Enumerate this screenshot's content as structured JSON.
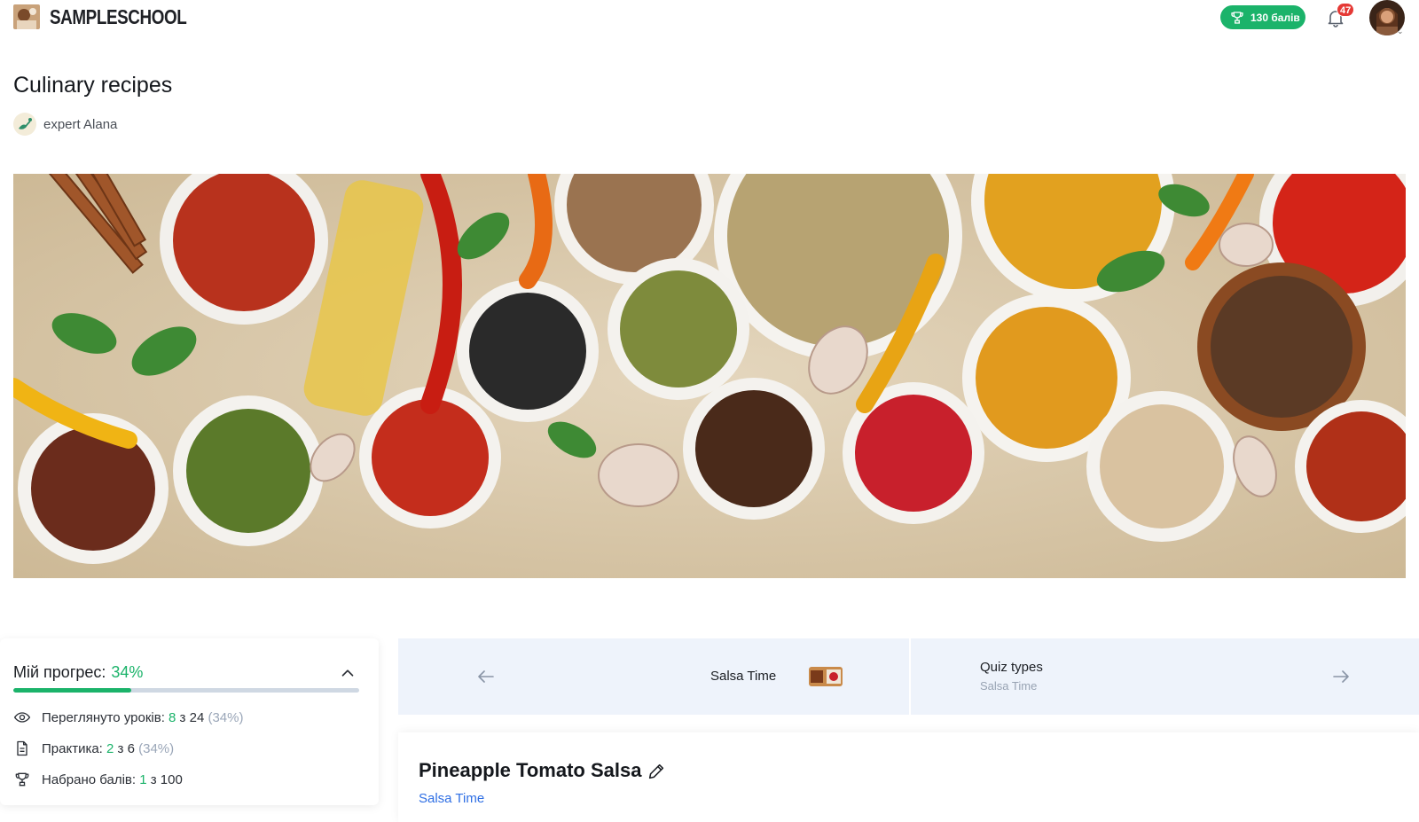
{
  "header": {
    "brand": "SAMPLESCHOOL",
    "points_label": "130 балів",
    "notifications_count": "47"
  },
  "course": {
    "title": "Culinary recipes",
    "author": "expert Alana"
  },
  "progress": {
    "title": "Мій прогрес:",
    "percent_label": "34%",
    "percent_value": 0.34,
    "lessons": {
      "label": "Переглянуто уроків:",
      "done": "8",
      "sep": " з ",
      "total": "24",
      "pct": " (34%)"
    },
    "practice": {
      "label": "Практика:",
      "done": "2",
      "sep": " з ",
      "total": "6",
      "pct": " (34%)"
    },
    "points": {
      "label": "Набрано балів:",
      "done": "1",
      "sep": " з ",
      "total": "100"
    }
  },
  "lesson_nav": {
    "prev_title": "Salsa Time",
    "next_title": "Quiz types",
    "next_subtitle": "Salsa Time"
  },
  "lesson": {
    "title": "Pineapple Tomato Salsa",
    "chapter": "Salsa Time"
  },
  "colors": {
    "accent_green": "#1bb36a",
    "link_blue": "#2f6fe4",
    "nav_bg": "#eef3fb",
    "badge_red": "#e53935"
  },
  "icons": [
    "trophy-icon",
    "bell-icon",
    "eye-icon",
    "document-icon",
    "chevron-up-icon",
    "arrow-left-icon",
    "arrow-right-icon",
    "pencil-icon"
  ]
}
